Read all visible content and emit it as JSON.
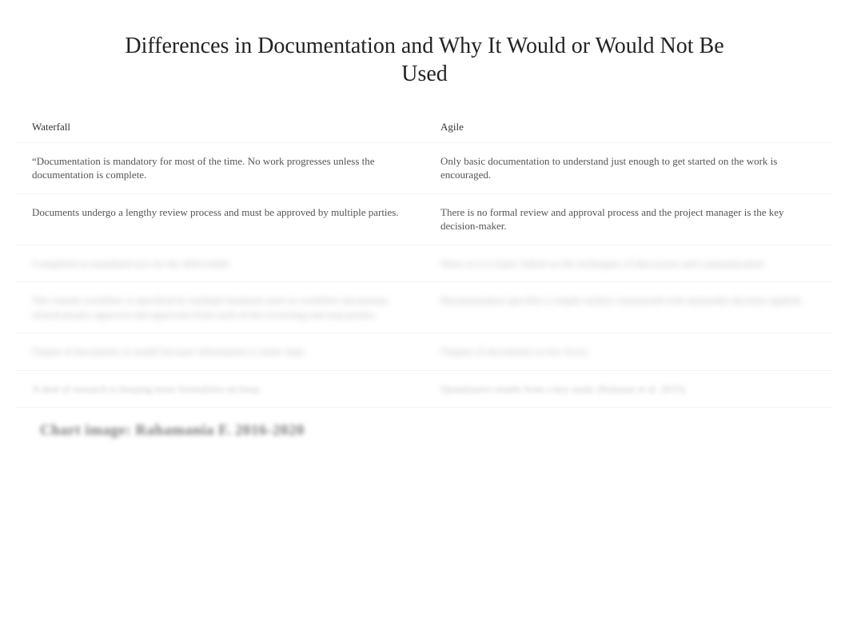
{
  "title": "Differences in Documentation and Why It Would or Would Not Be Used",
  "columns": {
    "left_header": "Waterfall",
    "right_header": "Agile"
  },
  "rows": [
    {
      "left": "“Documentation is mandatory for most of the time. No work progresses unless the documentation is complete.",
      "right": "Only basic documentation to understand just enough to get started on the work is encouraged."
    },
    {
      "left": "Documents undergo a lengthy review process and must be approved by multiple parties.",
      "right": "There is no formal review and approval process and the project manager is the key decision-maker."
    },
    {
      "left": "Completed in mandated size for the deliverable.",
      "right": "Short as it is faster linked on the techniques of discussion and communication.",
      "blur": true
    },
    {
      "left": "The custom workflow is specified by multiple handouts such as workflow documents, related project approval and approvals from each of the reviewing and stop parties.",
      "right": "Documentation specifies a simple outline constructed with minimally decision applied.",
      "blur": true
    },
    {
      "left": "Output of documents as model because information is easier kept.",
      "right": "Outputs of documents as low focus.",
      "blur": true
    },
    {
      "left": "A deal of research is keeping more formalities on keep.",
      "right": "Quantitative results from a key study (Rahman et al. 2015).",
      "blur": true
    }
  ],
  "footer_blur": "Chart image: Rahamania F. 2016-2020"
}
